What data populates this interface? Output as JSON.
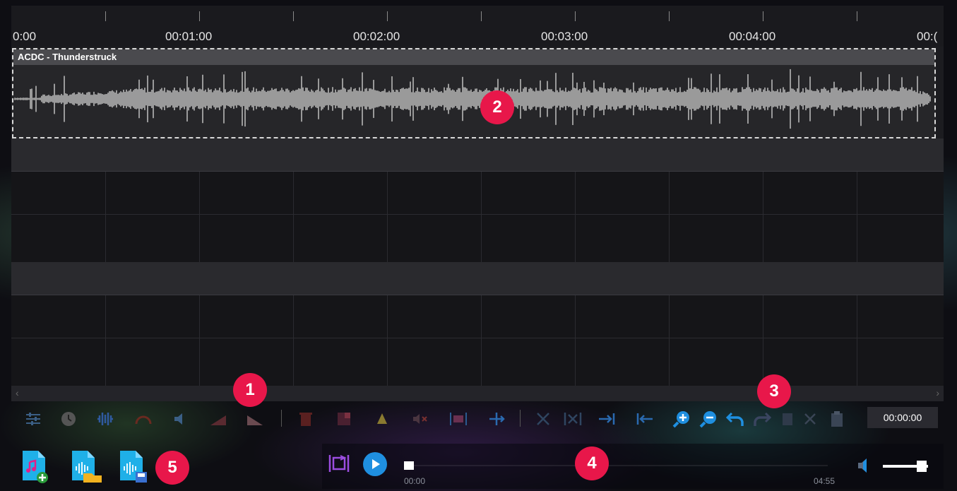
{
  "timeline": {
    "time_labels": [
      "0:00",
      "00:01:00",
      "00:02:00",
      "00:03:00",
      "00:04:00",
      "00:("
    ]
  },
  "track": {
    "clip_title": "ACDC - Thunderstruck"
  },
  "toolbar": {
    "current_time": "00:00:00",
    "icons": [
      "mixer-icon",
      "clock-icon",
      "normalize-icon",
      "speed-icon",
      "volume-icon",
      "fade-in-icon",
      "fade-out-icon",
      "delete-icon",
      "crop-icon",
      "effects-icon",
      "mute-icon",
      "trim-icon",
      "split-icon",
      "cut-icon",
      "cut-selection-icon",
      "move-right-icon",
      "move-left-icon",
      "zoom-in-icon",
      "zoom-out-icon",
      "undo-icon",
      "redo-icon",
      "paste-icon",
      "close-icon",
      "clipboard-icon"
    ]
  },
  "player": {
    "position_label": "00:00",
    "duration_label": "04:55",
    "progress": 0.0,
    "volume": 0.85
  },
  "file_buttons": [
    "add-audio-icon",
    "open-project-icon",
    "save-project-icon"
  ],
  "callouts": [
    "1",
    "2",
    "3",
    "4",
    "5"
  ],
  "colors": {
    "accent": "#1f8fe0",
    "badge": "#e8174a",
    "loop": "#9b4de0",
    "waveform": "#b8b8b8"
  }
}
